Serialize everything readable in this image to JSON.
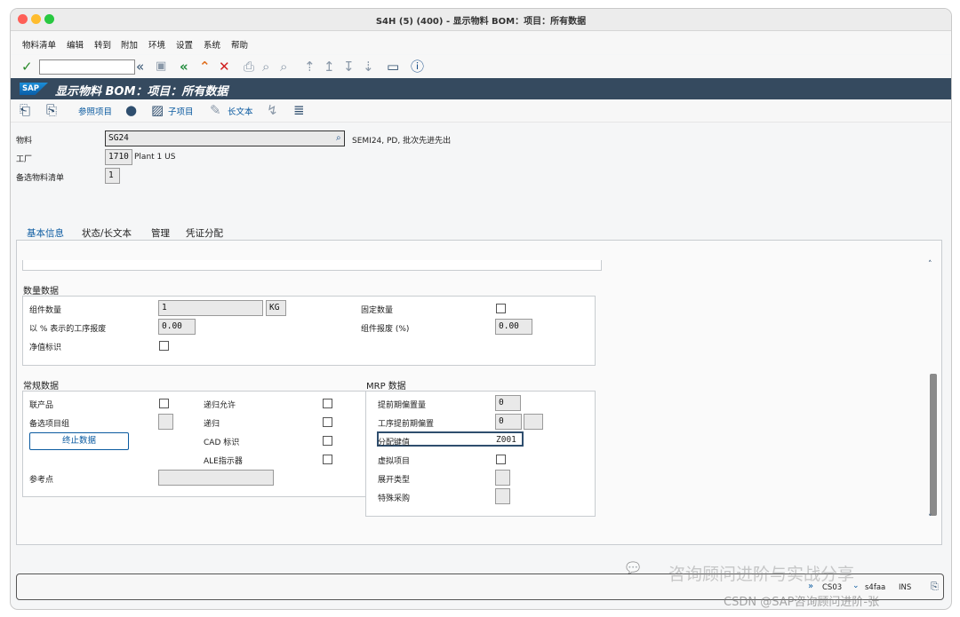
{
  "window": {
    "title": "S4H (5) (400) - 显示物料 BOM：项目：所有数据"
  },
  "menu": [
    "物料清单",
    "编辑",
    "转到",
    "附加",
    "环境",
    "设置",
    "系统",
    "帮助"
  ],
  "header": {
    "logo": "SAP",
    "title": "显示物料 BOM：项目：所有数据"
  },
  "app_toolbar": {
    "ref_item": "参照项目",
    "sub_item": "子项目",
    "long_text": "长文本"
  },
  "material": {
    "label": "物料",
    "value": "SG24",
    "desc": "SEMI24, PD, 批次先进先出",
    "plant_label": "工厂",
    "plant_value": "1710",
    "plant_desc": "Plant 1 US",
    "alt_label": "备选物料清单",
    "alt_value": "1"
  },
  "tabs": [
    "基本信息",
    "状态/长文本",
    "管理",
    "凭证分配"
  ],
  "qty": {
    "title": "数量数据",
    "comp_qty_label": "组件数量",
    "comp_qty_value": "1",
    "unit": "KG",
    "fixed_qty_label": "固定数量",
    "op_scrap_label": "以 % 表示的工序报废",
    "op_scrap_value": "0.00",
    "comp_scrap_label": "组件报废 (%)",
    "comp_scrap_value": "0.00",
    "net_label": "净值标识"
  },
  "general": {
    "title": "常规数据",
    "coproduct": "联产品",
    "recursive_allowed": "递归允许",
    "alt_group": "备选项目组",
    "recursive": "递归",
    "end_data_btn": "终止数据",
    "cad": "CAD 标识",
    "ale": "ALE指示器",
    "ref_point": "参考点"
  },
  "mrp": {
    "title": "MRP 数据",
    "lead_offset_label": "提前期偏置量",
    "lead_offset_value": "0",
    "op_lead_offset_label": "工序提前期偏置",
    "op_lead_offset_value": "0",
    "dist_key_label": "分配键值",
    "dist_key_value": "Z001",
    "phantom_label": "虚拟项目",
    "explosion_label": "展开类型",
    "special_label": "特殊采购"
  },
  "status": {
    "tcode": "CS03",
    "server": "s4faa",
    "mode": "INS"
  },
  "watermark": {
    "line1": "咨询顾问进阶与实战分享",
    "line2": "CSDN @SAP咨询顾问进阶-张"
  }
}
